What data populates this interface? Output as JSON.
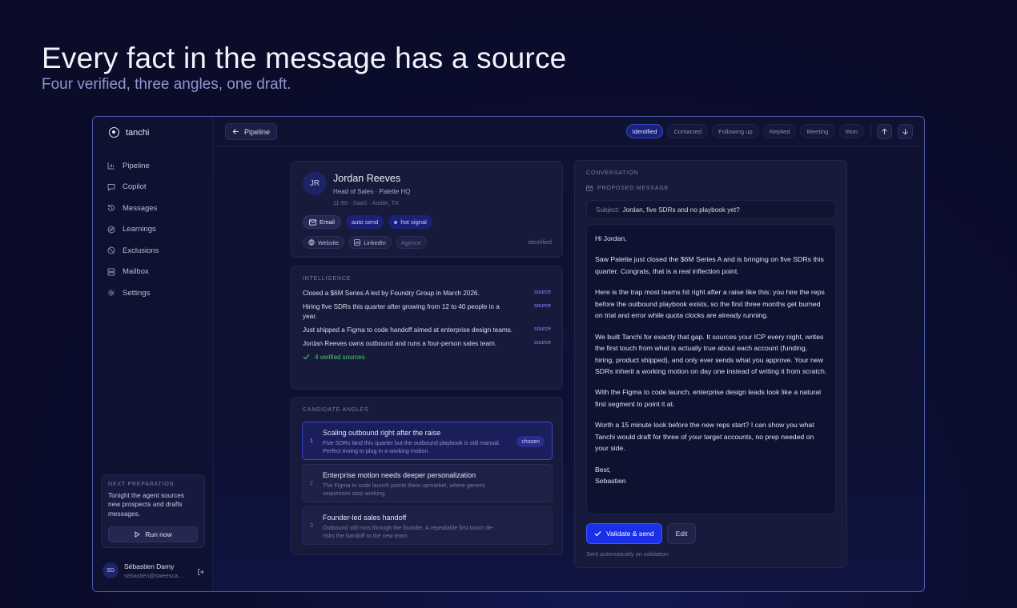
{
  "hero": {
    "title": "Every fact in the message has a source",
    "subtitle": "Four verified, three angles, one draft."
  },
  "app": {
    "name": "tanchi"
  },
  "sidebar": {
    "items": [
      {
        "label": "Pipeline",
        "icon": "chart-icon"
      },
      {
        "label": "Copilot",
        "icon": "chat-icon"
      },
      {
        "label": "Messages",
        "icon": "history-icon"
      },
      {
        "label": "Learnings",
        "icon": "compass-icon"
      },
      {
        "label": "Exclusions",
        "icon": "ban-icon"
      },
      {
        "label": "Mailbox",
        "icon": "server-icon"
      },
      {
        "label": "Settings",
        "icon": "gear-icon"
      }
    ],
    "prep": {
      "eyebrow": "NEXT PREPARATION",
      "text": "Tonight the agent sources new prospects and drafts messages.",
      "run_label": "Run now"
    },
    "user": {
      "initials": "SD",
      "name": "Sébastien Damy",
      "email": "sebastien@sweesca..."
    }
  },
  "topbar": {
    "back_label": "Pipeline",
    "stages": [
      "Identified",
      "Contacted",
      "Following up",
      "Replied",
      "Meeting",
      "Won"
    ],
    "active_stage": "Identified"
  },
  "profile": {
    "initials": "JR",
    "name": "Jordan Reeves",
    "role": "Head of Sales · Palette HQ",
    "meta": "11-50 · SaaS · Austin, TX",
    "channel": "Email",
    "tags": [
      "auto send",
      "hot signal"
    ],
    "links": [
      "Website",
      "LinkedIn",
      "Agence"
    ],
    "status": "Identified"
  },
  "intelligence": {
    "eyebrow": "INTELLIGENCE",
    "facts": [
      {
        "text": "Closed a $6M Series A led by Foundry Group in March 2026.",
        "source": "source"
      },
      {
        "text": "Hiring five SDRs this quarter after growing from 12 to 40 people in a year.",
        "source": "source"
      },
      {
        "text": "Just shipped a Figma to code handoff aimed at enterprise design teams.",
        "source": "source"
      },
      {
        "text": "Jordan Reeves owns outbound and runs a four-person sales team.",
        "source": "source"
      }
    ],
    "verified_label": "4 verified sources"
  },
  "angles": {
    "eyebrow": "CANDIDATE ANGLES",
    "items": [
      {
        "num": "1",
        "title": "Scaling outbound right after the raise",
        "desc": "Five SDRs land this quarter but the outbound playbook is still manual. Perfect timing to plug in a working motion.",
        "badge": "chosen"
      },
      {
        "num": "2",
        "title": "Enterprise motion needs deeper personalization",
        "desc": "The Figma to code launch points them upmarket, where generic sequences stop working."
      },
      {
        "num": "3",
        "title": "Founder-led sales handoff",
        "desc": "Outbound still runs through the founder. A repeatable first touch de-risks the handoff to the new team."
      }
    ]
  },
  "conversation": {
    "eyebrow": "CONVERSATION",
    "proposed_label": "PROPOSED MESSAGE",
    "subject_label": "Subject:",
    "subject": "Jordan, five SDRs and no playbook yet?",
    "body": [
      "Hi Jordan,",
      "Saw Palette just closed the $6M Series A and is bringing on five SDRs this quarter. Congrats, that is a real inflection point.",
      "Here is the trap most teams hit right after a raise like this: you hire the reps before the outbound playbook exists, so the first three months get burned on trial and error while quota clocks are already running.",
      "We built Tanchi for exactly that gap. It sources your ICP every night, writes the first touch from what is actually true about each account (funding, hiring, product shipped), and only ever sends what you approve. Your new SDRs inherit a working motion on day one instead of writing it from scratch.",
      "With the Figma to code launch, enterprise design leads look like a natural first segment to point it at.",
      "Worth a 15 minute look before the new reps start? I can show you what Tanchi would draft for three of your target accounts, no prep needed on your side.",
      "Best,\nSebastien"
    ],
    "validate_label": "Validate & send",
    "edit_label": "Edit",
    "note": "Sent automatically on validation"
  }
}
